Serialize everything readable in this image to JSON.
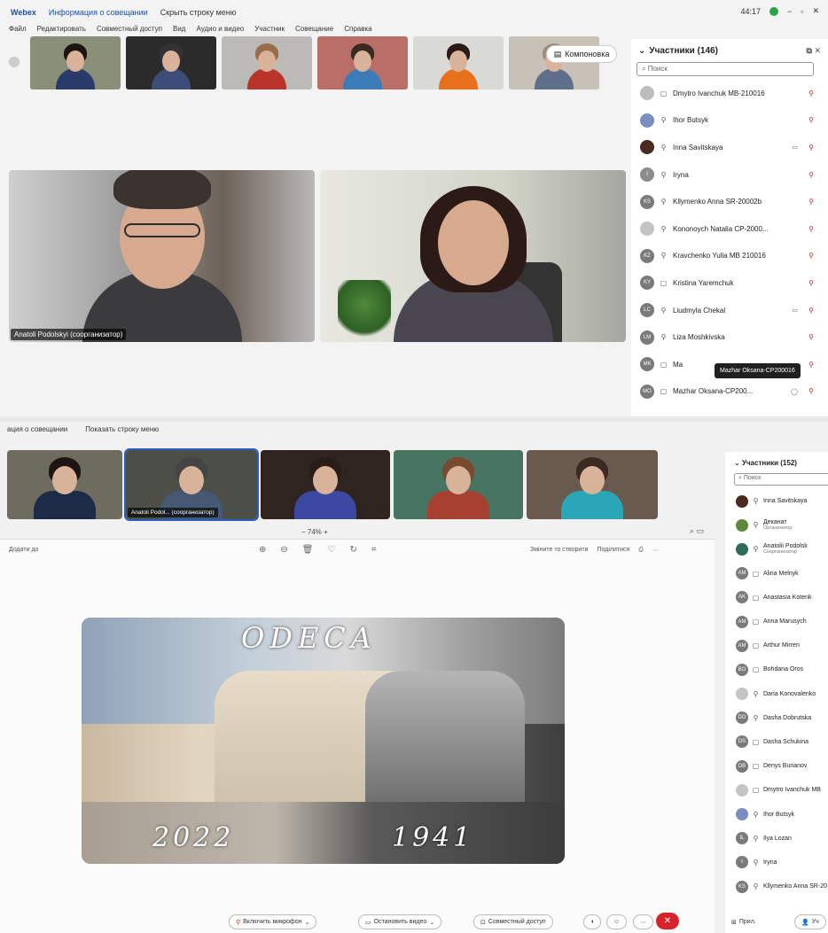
{
  "top": {
    "titlebar": {
      "app": "Webex",
      "meeting_info": "Информация о совещании",
      "hide_menu": "Скрыть строку меню",
      "time": "44:17",
      "minimize": "−",
      "restore": "▫",
      "close": "✕"
    },
    "menu": [
      "Файл",
      "Редактировать",
      "Совместный доступ",
      "Вид",
      "Аудио и видео",
      "Участник",
      "Совещание",
      "Справка"
    ],
    "layout_button": "Компоновка",
    "thumbs": [
      {
        "bg": "#8a8f78",
        "shirt": "#2a3a6b",
        "hair": "#1d1412"
      },
      {
        "bg": "#2b2b2b",
        "shirt": "#3c4d7a",
        "hair": "#333"
      },
      {
        "bg": "#bcbab6",
        "shirt": "#b9352c",
        "hair": "#9a6d4a"
      },
      {
        "bg": "#b96f68",
        "shirt": "#3a7bb8",
        "hair": "#3a2a22"
      },
      {
        "bg": "#d9d9d6",
        "shirt": "#e8701a",
        "hair": "#2b1a16"
      },
      {
        "bg": "#c7c1b7",
        "shirt": "#5d6f8a",
        "hair": "#a08c7a"
      }
    ],
    "main_video_label": "Anatoli Podolskyi (соорганизатор)",
    "participants_title": "Участники (146)",
    "search_placeholder": "Поиск",
    "participants": [
      {
        "name": "Dmytro Ivanchuk MB-210016",
        "initials": "",
        "color": "#bdbdbd",
        "icon": "▢",
        "cam": ""
      },
      {
        "name": "Ihor Butsyk",
        "initials": "",
        "color": "#7a8ec0",
        "icon": "⚲",
        "cam": ""
      },
      {
        "name": "Inna Savitskaya",
        "initials": "",
        "color": "#4a2a1e",
        "icon": "⚲",
        "cam": "▭"
      },
      {
        "name": "Iryna",
        "initials": "I",
        "color": "#8b8b8b",
        "icon": "⚲",
        "cam": ""
      },
      {
        "name": "Kllymenko Anna SR-20002b",
        "initials": "KS",
        "color": "#7a7a7a",
        "icon": "⚲",
        "cam": ""
      },
      {
        "name": "Kononoych Natalia CP-2000...",
        "initials": "",
        "color": "#c4c4c4",
        "icon": "⚲",
        "cam": ""
      },
      {
        "name": "Kravchenko Yulia MB 210016",
        "initials": "KZ",
        "color": "#7a7a7a",
        "icon": "⚲",
        "cam": ""
      },
      {
        "name": "Kristina Yaremchuk",
        "initials": "KY",
        "color": "#7a7a7a",
        "icon": "▢",
        "cam": ""
      },
      {
        "name": "Liudmyla Chekal",
        "initials": "LC",
        "color": "#7a7a7a",
        "icon": "⚲",
        "cam": "▭"
      },
      {
        "name": "Liza Moshkivska",
        "initials": "LM",
        "color": "#7a7a7a",
        "icon": "⚲",
        "cam": ""
      },
      {
        "name": "Ma",
        "initials": "MK",
        "color": "#7a7a7a",
        "icon": "▢",
        "cam": ""
      },
      {
        "name": "Mazhar Oksana-CP200...",
        "initials": "MO",
        "color": "#7a7a7a",
        "icon": "▢",
        "cam": "◯"
      }
    ],
    "tooltip": "Mazhar Oksana-CP200016",
    "controls": {
      "mic": "Включить микрофон",
      "video": "Остановить видео",
      "share": "Совместный доступ",
      "end": "✕"
    }
  },
  "bottom": {
    "titlebar": {
      "meeting_info": "ация о совещании",
      "show_menu": "Показать строку меню"
    },
    "thumbs": [
      {
        "w": 130,
        "bg": "#6d6c5e",
        "shirt": "#1d2a48",
        "hair": "#1e1512",
        "label": ""
      },
      {
        "w": 148,
        "bg": "#4c4e48",
        "shirt": "#475873",
        "hair": "#444",
        "label": "Anatoli Podol... (соорганизатор)",
        "selected": true
      },
      {
        "w": 146,
        "bg": "#2f2420",
        "shirt": "#3b4aa0",
        "hair": "#2a1c16",
        "label": ""
      },
      {
        "w": 146,
        "bg": "#487562",
        "shirt": "#a64030",
        "hair": "#7a4a30",
        "label": ""
      },
      {
        "w": 148,
        "bg": "#6a5a4e",
        "shirt": "#2aa6b8",
        "hair": "#3a2a22",
        "label": ""
      }
    ],
    "zoom": "−  74%  +",
    "viewer_left": "Додати до",
    "viewer_right_a": "Зміните то створити",
    "viewer_right_b": "Поділитися",
    "poster": {
      "title": "ODECA",
      "year_left": "2022",
      "year_right": "1941"
    },
    "participants_title": "Участники (152)",
    "search_placeholder": "Поиск",
    "participants": [
      {
        "name": "Inna Savitskaya",
        "sub": "",
        "color": "#4a2a1e",
        "icon": "⚲",
        "init": ""
      },
      {
        "name": "Деканат",
        "sub": "Организатор",
        "color": "#5a8a3a",
        "icon": "⚲",
        "init": ""
      },
      {
        "name": "Anatolii Podolsk",
        "sub": "Соорганизатор",
        "color": "#2d6b5a",
        "icon": "⚲",
        "init": ""
      },
      {
        "name": "Alina Melnyk",
        "sub": "",
        "color": "#7a7a7a",
        "icon": "▢",
        "init": "AM"
      },
      {
        "name": "Anastasia Kotenk",
        "sub": "",
        "color": "#7a7a7a",
        "icon": "▢",
        "init": "AK"
      },
      {
        "name": "Anna Marusych",
        "sub": "",
        "color": "#7a7a7a",
        "icon": "▢",
        "init": "AM"
      },
      {
        "name": "Arthur Mirren",
        "sub": "",
        "color": "#7a7a7a",
        "icon": "▢",
        "init": "AM"
      },
      {
        "name": "Bohdana Oros",
        "sub": "",
        "color": "#7a7a7a",
        "icon": "▢",
        "init": "BO"
      },
      {
        "name": "Daria Konovalenko",
        "sub": "",
        "color": "#c4c4c4",
        "icon": "⚲",
        "init": ""
      },
      {
        "name": "Dasha Dobrutska",
        "sub": "",
        "color": "#7a7a7a",
        "icon": "⚲",
        "init": "DD"
      },
      {
        "name": "Dasha Schukina",
        "sub": "",
        "color": "#7a7a7a",
        "icon": "▢",
        "init": "DS"
      },
      {
        "name": "Denys Burianov",
        "sub": "",
        "color": "#7a7a7a",
        "icon": "▢",
        "init": "DB"
      },
      {
        "name": "Dmytro Ivanchuk MB",
        "sub": "",
        "color": "#c4c4c4",
        "icon": "▢",
        "init": ""
      },
      {
        "name": "Ihor Butsyk",
        "sub": "",
        "color": "#7a8ec0",
        "icon": "⚲",
        "init": ""
      },
      {
        "name": "Ilya Lozan",
        "sub": "",
        "color": "#7a7a7a",
        "icon": "⚲",
        "init": "IL"
      },
      {
        "name": "Iryna",
        "sub": "",
        "color": "#7a7a7a",
        "icon": "⚲",
        "init": "I"
      },
      {
        "name": "Kllymenko Anna SR-20",
        "sub": "",
        "color": "#7a7a7a",
        "icon": "⚲",
        "init": "KS"
      }
    ],
    "controls": {
      "mic": "Включить микрофон",
      "video": "Остановить видео",
      "share": "Совместный доступ",
      "end": "✕",
      "apps": "Прил.",
      "participants_short": "Уч"
    }
  }
}
